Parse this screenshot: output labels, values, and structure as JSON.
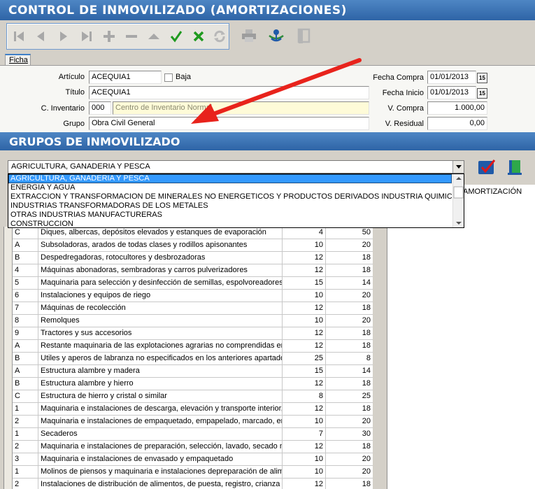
{
  "window": {
    "title": "CONTROL DE INMOVILIZADO (AMORTIZACIONES)"
  },
  "toolbar": {
    "icons": [
      "first-icon",
      "prev-icon",
      "next-icon",
      "last-icon",
      "add-icon",
      "delete-icon",
      "up-icon",
      "confirm-icon",
      "cancel-icon",
      "refresh-icon",
      "print-icon",
      "network-icon",
      "exit-icon"
    ],
    "colors": {
      "confirm": "#1f9a1f",
      "cancel": "#1f9a1f",
      "disabled": "#a8a8a8",
      "accent": "#1f5aa8"
    }
  },
  "tabs": {
    "ficha": "Ficha"
  },
  "form": {
    "articulo_label": "Artículo",
    "articulo_value": "ACEQUIA1",
    "baja_label": "Baja",
    "titulo_label": "Título",
    "titulo_value": "ACEQUIA1",
    "inventario_label": "C. Inventario",
    "inventario_code": "000",
    "inventario_name": "Centro de Inventario Normal",
    "grupo_label": "Grupo",
    "grupo_value": "Obra Civil General",
    "fecha_compra_label": "Fecha Compra",
    "fecha_compra_value": "01/01/2013",
    "fecha_inicio_label": "Fecha Inicio",
    "fecha_inicio_value": "01/01/2013",
    "v_compra_label": "V. Compra",
    "v_compra_value": "1.000,00",
    "v_residual_label": "V. Residual",
    "v_residual_value": "0,00",
    "calendar_glyph": "15"
  },
  "groups": {
    "title": "GRUPOS DE INMOVILIZADO",
    "selected": "AGRICULTURA, GANADERIA Y PESCA",
    "options": [
      "AGRICULTURA, GANADERIA Y PESCA",
      "ENERGIA Y AGUA",
      "EXTRACCION Y TRANSFORMACION DE MINERALES NO ENERGETICOS Y PRODUCTOS DERIVADOS INDUSTRIA QUIMICA",
      "INDUSTRIAS TRANSFORMADORAS DE LOS METALES",
      "OTRAS INDUSTRIAS MANUFACTURERAS",
      "CONSTRUCCION"
    ],
    "right_header": "AMORTIZACIÓN"
  },
  "table": {
    "rows": [
      {
        "code": "C",
        "desc": "Diques, albercas, depósitos elevados y estanques de evaporación",
        "c1": "4",
        "c2": "50"
      },
      {
        "code": "A",
        "desc": "Subsoladoras, arados de todas clases y rodillos apisonantes",
        "c1": "10",
        "c2": "20"
      },
      {
        "code": "B",
        "desc": "Despedregadoras, rotocultores y desbrozadoras",
        "c1": "12",
        "c2": "18"
      },
      {
        "code": "4",
        "desc": "Máquinas abonadoras, sembradoras y carros pulverizadores",
        "c1": "12",
        "c2": "18"
      },
      {
        "code": "5",
        "desc": "Maquinaria para selección y desinfección de semillas, espolvoreadores y",
        "c1": "15",
        "c2": "14"
      },
      {
        "code": "6",
        "desc": "Instalaciones y equipos de riego",
        "c1": "10",
        "c2": "20"
      },
      {
        "code": "7",
        "desc": "Máquinas de recolección",
        "c1": "12",
        "c2": "18"
      },
      {
        "code": "8",
        "desc": "Remolques",
        "c1": "10",
        "c2": "20"
      },
      {
        "code": "9",
        "desc": "Tractores y sus accesorios",
        "c1": "12",
        "c2": "18"
      },
      {
        "code": "A",
        "desc": "Restante maquinaria de las explotaciones agrarias no comprendidas en lo",
        "c1": "12",
        "c2": "18"
      },
      {
        "code": "B",
        "desc": "Utiles y aperos de labranza no especificados en los anteriores apartados",
        "c1": "25",
        "c2": "8"
      },
      {
        "code": "A",
        "desc": "Estructura alambre y madera",
        "c1": "15",
        "c2": "14"
      },
      {
        "code": "B",
        "desc": "Estructura alambre y hierro",
        "c1": "12",
        "c2": "18"
      },
      {
        "code": "C",
        "desc": "Estructura de hierro y cristal o similar",
        "c1": "8",
        "c2": "25"
      },
      {
        "code": "1",
        "desc": "Maquinaria e instalaciones de descarga, elevación y transporte interior, d",
        "c1": "12",
        "c2": "18"
      },
      {
        "code": "2",
        "desc": "Maquinaria e instalaciones de empaquetado, empapelado, marcado, env",
        "c1": "10",
        "c2": "20"
      },
      {
        "code": "1",
        "desc": "Secaderos",
        "c1": "7",
        "c2": "30"
      },
      {
        "code": "2",
        "desc": "Maquinaria e instalaciones de preparación, selección, lavado, secado me",
        "c1": "12",
        "c2": "18"
      },
      {
        "code": "3",
        "desc": "Maquinaria e instalaciones de envasado y empaquetado",
        "c1": "10",
        "c2": "20"
      },
      {
        "code": "1",
        "desc": "Molinos de piensos y maquinaria e instalaciones depreparación de alimen",
        "c1": "10",
        "c2": "20"
      },
      {
        "code": "2",
        "desc": "Instalaciones de distribución de alimentos, de puesta, registro, crianza y r",
        "c1": "12",
        "c2": "18"
      }
    ]
  }
}
